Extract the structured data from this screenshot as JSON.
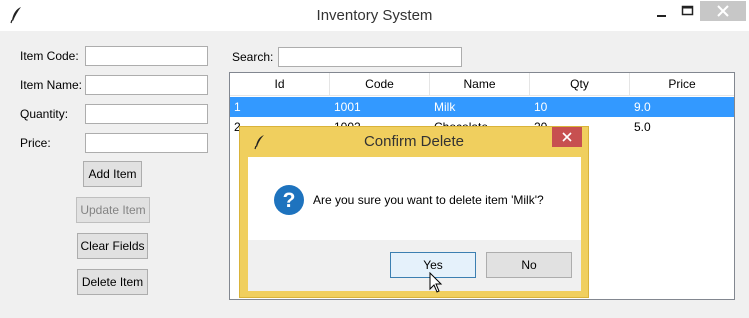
{
  "window": {
    "title": "Inventory System"
  },
  "form": {
    "item_code_label": "Item Code:",
    "item_name_label": "Item Name:",
    "quantity_label": "Quantity:",
    "price_label": "Price:",
    "item_code_value": "",
    "item_name_value": "",
    "quantity_value": "",
    "price_value": ""
  },
  "buttons": {
    "add": "Add Item",
    "update": "Update Item",
    "clear": "Clear Fields",
    "delete": "Delete Item"
  },
  "search": {
    "label": "Search:",
    "value": ""
  },
  "table": {
    "columns": [
      "Id",
      "Code",
      "Name",
      "Qty",
      "Price"
    ],
    "rows": [
      {
        "id": "1",
        "code": "1001",
        "name": "Milk",
        "qty": "10",
        "price": "9.0",
        "selected": true
      },
      {
        "id": "2",
        "code": "1002",
        "name": "Chocolate",
        "qty": "20",
        "price": "5.0",
        "selected": false
      }
    ]
  },
  "dialog": {
    "title": "Confirm Delete",
    "message": "Are you sure you want to delete item 'Milk'?",
    "yes_label": "Yes",
    "no_label": "No"
  },
  "colors": {
    "selection": "#3399ff",
    "dialog_frame": "#f0cf5e",
    "dialog_close": "#c75050",
    "question_icon": "#1e73be"
  },
  "icons": [
    "feather-icon",
    "minimize-icon",
    "maximize-icon",
    "close-icon",
    "question-icon",
    "mouse-cursor-icon"
  ]
}
